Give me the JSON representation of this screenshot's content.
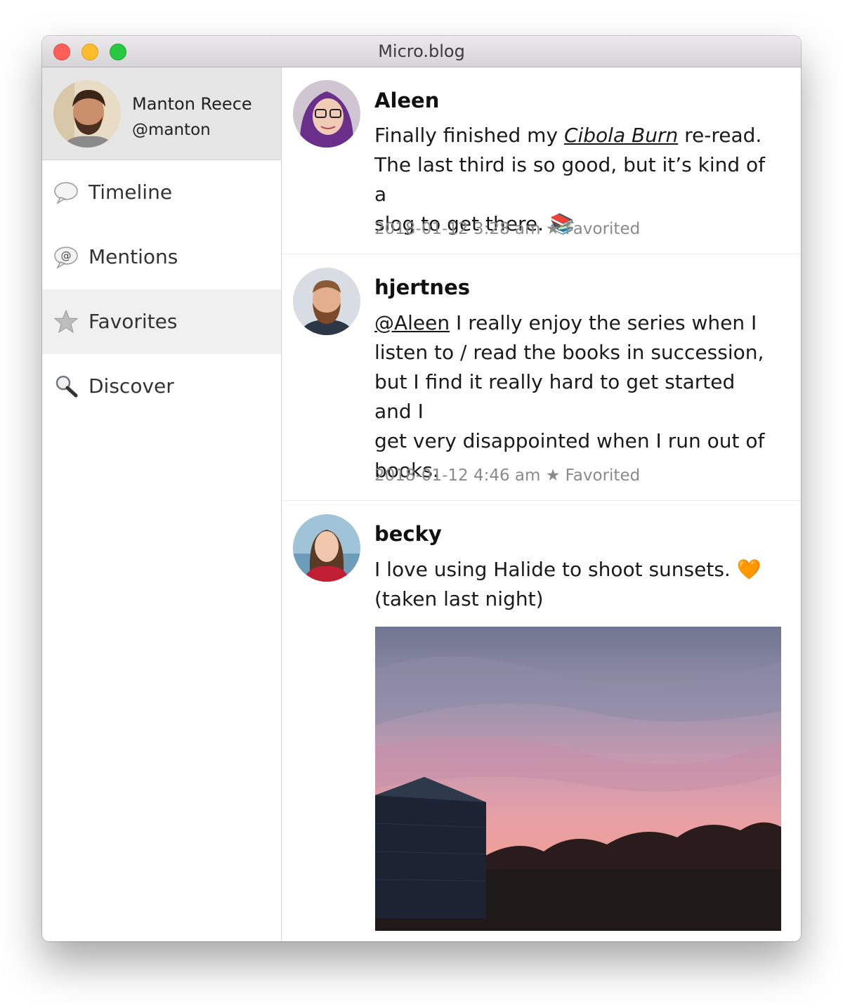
{
  "window": {
    "title": "Micro.blog"
  },
  "sidebar": {
    "profile": {
      "name": "Manton Reece",
      "handle": "@manton"
    },
    "items": [
      {
        "label": "Timeline",
        "icon": "speech-bubble-icon",
        "selected": false
      },
      {
        "label": "Mentions",
        "icon": "at-sign-icon",
        "selected": false
      },
      {
        "label": "Favorites",
        "icon": "star-icon",
        "selected": true
      },
      {
        "label": "Discover",
        "icon": "magnifier-icon",
        "selected": false
      }
    ]
  },
  "posts": [
    {
      "username": "Aleen",
      "text_before": "Finally finished my ",
      "link_text": "Cibola Burn",
      "text_after_line1": " re-read.",
      "text_line2": "The last third is so good, but it’s kind of a",
      "text_line3": "slog to get there. 📚",
      "timestamp": "2018-01-12 3:28 am",
      "status": "★ Favorited"
    },
    {
      "username": "hjertnes",
      "mention": "@Aleen",
      "text_after_mention": " I really enjoy the series when I",
      "text_line2": "listen to / read the books in succession,",
      "text_line3": "but I find it really hard to get started and I",
      "text_line4": "get very disappointed when I run out of",
      "text_line5": "books.",
      "timestamp": "2018-01-12 4:46 am",
      "status": "★ Favorited"
    },
    {
      "username": "becky",
      "text_line1": "I love using Halide to shoot sunsets. 🧡",
      "text_line2": "(taken last night)"
    }
  ]
}
